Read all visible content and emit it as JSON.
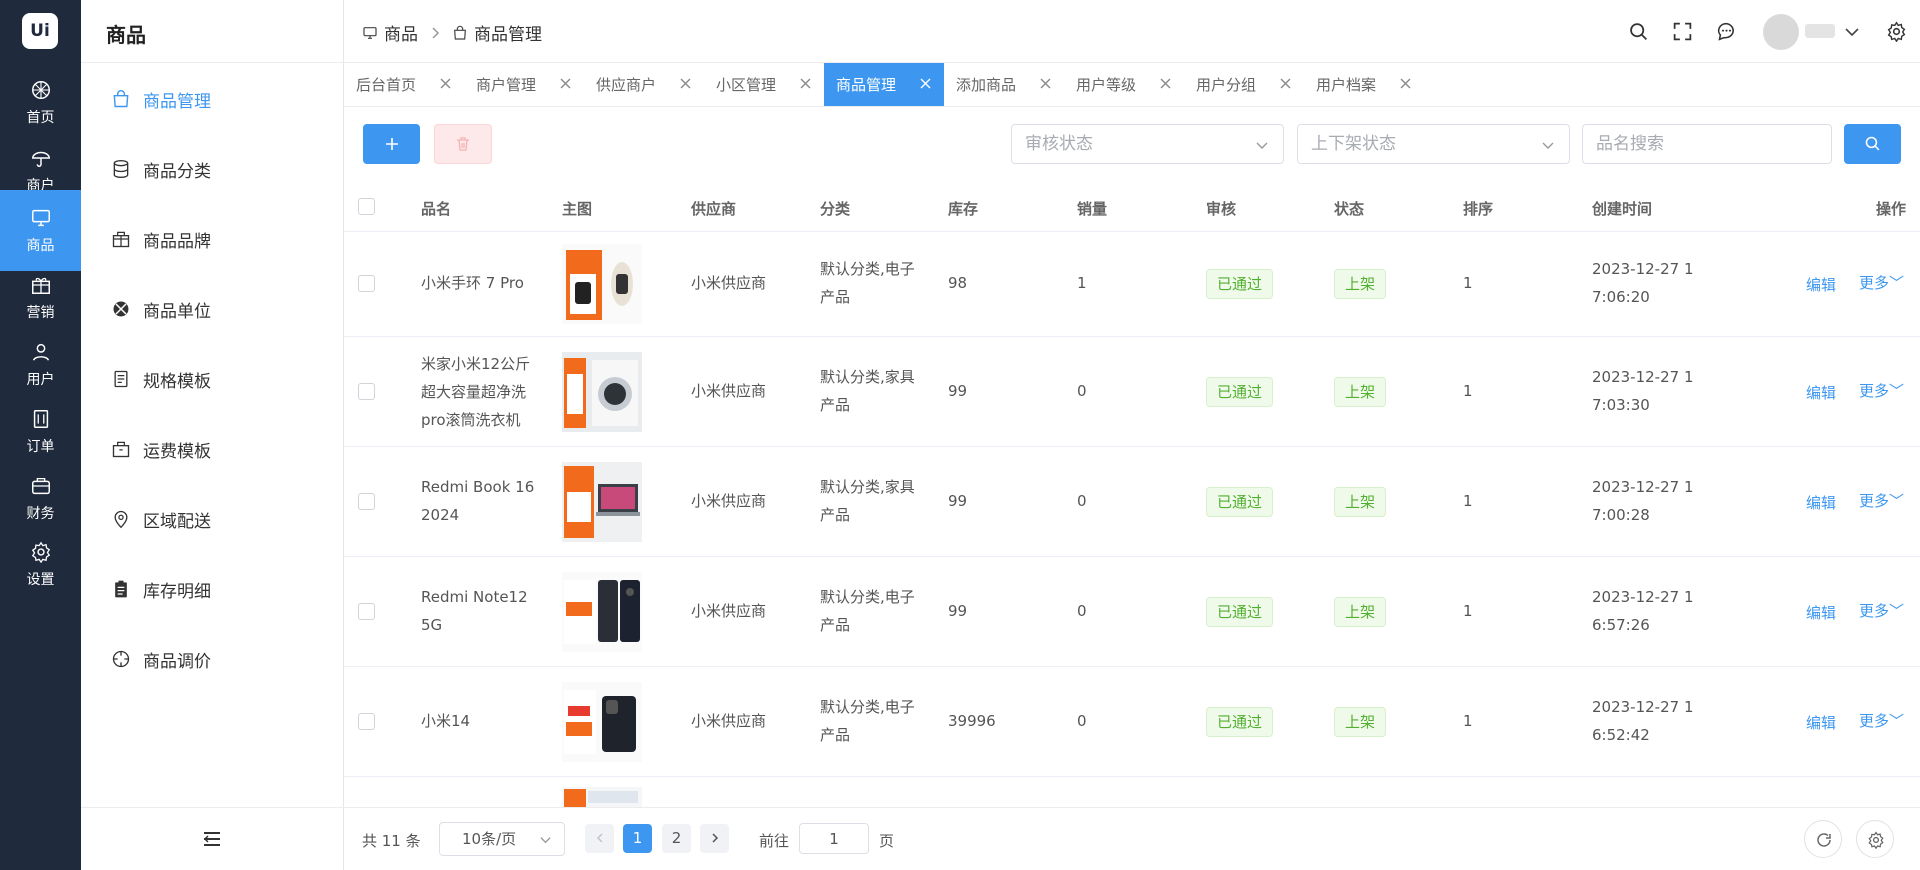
{
  "rail": {
    "logo": "Ui",
    "items": [
      {
        "label": "首页",
        "icon": "home-icon"
      },
      {
        "label": "商户",
        "icon": "merchant-icon"
      },
      {
        "label": "商品",
        "icon": "goods-monitor-icon",
        "active": true
      },
      {
        "label": "营销",
        "icon": "gift-icon"
      },
      {
        "label": "用户",
        "icon": "user-icon"
      },
      {
        "label": "订单",
        "icon": "order-icon"
      },
      {
        "label": "财务",
        "icon": "wallet-icon"
      },
      {
        "label": "设置",
        "icon": "gear-icon"
      }
    ]
  },
  "sidebar": {
    "title": "商品",
    "items": [
      {
        "label": "商品管理",
        "icon": "shopping-bag-icon",
        "active": true
      },
      {
        "label": "商品分类",
        "icon": "database-icon"
      },
      {
        "label": "商品品牌",
        "icon": "gift-box-icon"
      },
      {
        "label": "商品单位",
        "icon": "radar-icon"
      },
      {
        "label": "规格模板",
        "icon": "document-icon"
      },
      {
        "label": "运费模板",
        "icon": "package-icon"
      },
      {
        "label": "区域配送",
        "icon": "location-pin-icon"
      },
      {
        "label": "库存明细",
        "icon": "clipboard-icon"
      },
      {
        "label": "商品调价",
        "icon": "compass-icon"
      }
    ]
  },
  "header": {
    "breadcrumb": [
      "商品",
      "商品管理"
    ]
  },
  "tabs": [
    {
      "label": "后台首页"
    },
    {
      "label": "商户管理"
    },
    {
      "label": "供应商户"
    },
    {
      "label": "小区管理"
    },
    {
      "label": "商品管理",
      "active": true
    },
    {
      "label": "添加商品"
    },
    {
      "label": "用户等级"
    },
    {
      "label": "用户分组"
    },
    {
      "label": "用户档案"
    }
  ],
  "toolbar": {
    "audit_placeholder": "审核状态",
    "shelf_placeholder": "上下架状态",
    "search_placeholder": "品名搜索"
  },
  "table": {
    "columns": [
      "品名",
      "主图",
      "供应商",
      "分类",
      "库存",
      "销量",
      "审核",
      "状态",
      "排序",
      "创建时间",
      "操作"
    ],
    "rows": [
      {
        "name": [
          "小米手环 7 Pro"
        ],
        "supplier": "小米供应商",
        "category": [
          "默认分类,电子",
          "产品"
        ],
        "stock": "98",
        "sales": "1",
        "audit": "已通过",
        "status": "上架",
        "sort": "1",
        "created": [
          "2023-12-27 1",
          "7:06:20"
        ],
        "edit": "编辑",
        "more": "更多"
      },
      {
        "name": [
          "米家小米12公斤",
          "超大容量超净洗",
          "pro滚筒洗衣机"
        ],
        "supplier": "小米供应商",
        "category": [
          "默认分类,家具",
          "产品"
        ],
        "stock": "99",
        "sales": "0",
        "audit": "已通过",
        "status": "上架",
        "sort": "1",
        "created": [
          "2023-12-27 1",
          "7:03:30"
        ],
        "edit": "编辑",
        "more": "更多"
      },
      {
        "name": [
          "Redmi Book 16",
          "2024"
        ],
        "supplier": "小米供应商",
        "category": [
          "默认分类,家具",
          "产品"
        ],
        "stock": "99",
        "sales": "0",
        "audit": "已通过",
        "status": "上架",
        "sort": "1",
        "created": [
          "2023-12-27 1",
          "7:00:28"
        ],
        "edit": "编辑",
        "more": "更多"
      },
      {
        "name": [
          "Redmi Note12",
          "5G"
        ],
        "supplier": "小米供应商",
        "category": [
          "默认分类,电子",
          "产品"
        ],
        "stock": "99",
        "sales": "0",
        "audit": "已通过",
        "status": "上架",
        "sort": "1",
        "created": [
          "2023-12-27 1",
          "6:57:26"
        ],
        "edit": "编辑",
        "more": "更多"
      },
      {
        "name": [
          "小米14"
        ],
        "supplier": "小米供应商",
        "category": [
          "默认分类,电子",
          "产品"
        ],
        "stock": "39996",
        "sales": "0",
        "audit": "已通过",
        "status": "上架",
        "sort": "1",
        "created": [
          "2023-12-27 1",
          "6:52:42"
        ],
        "edit": "编辑",
        "more": "更多"
      }
    ]
  },
  "footer": {
    "total": "共 11 条",
    "page_size": "10条/页",
    "pages": [
      "1",
      "2"
    ],
    "current_page": "1",
    "goto_label": "前往",
    "goto_value": "1",
    "page_suffix": "页"
  },
  "colors": {
    "rail_bg": "#1f2a3c",
    "accent": "#3d97f0",
    "success_tag": "#52b030"
  }
}
